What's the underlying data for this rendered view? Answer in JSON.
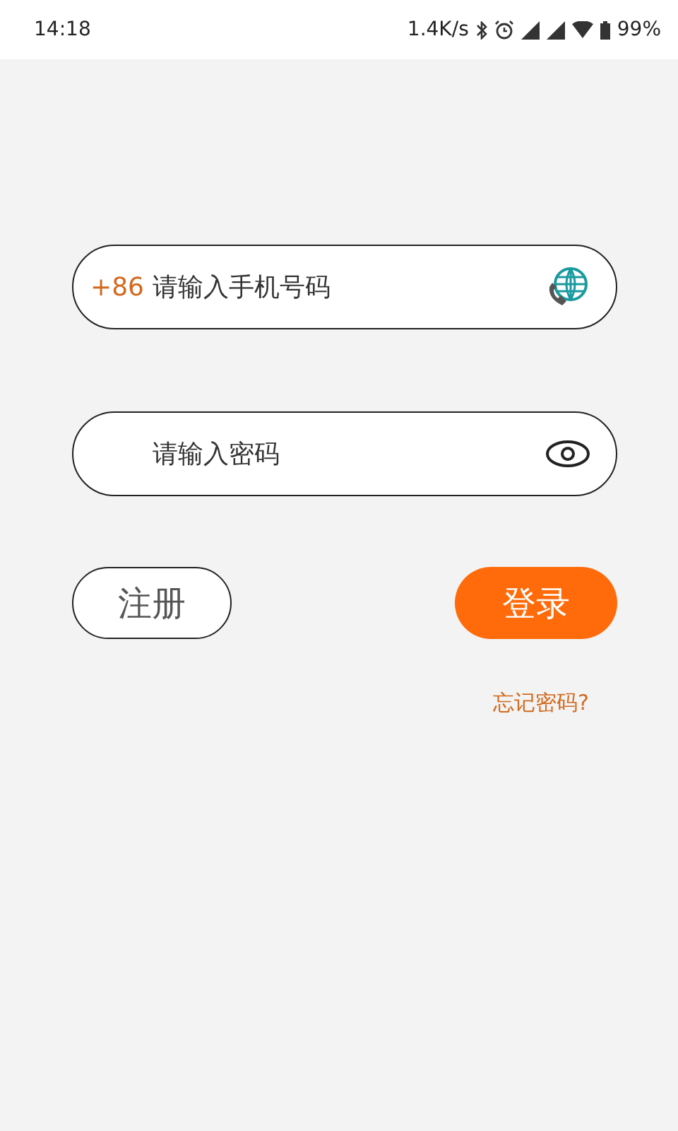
{
  "status_bar": {
    "time": "14:18",
    "speed": "1.4K/s",
    "battery": "99%"
  },
  "phone_field": {
    "country_code": "+86",
    "placeholder": "请输入手机号码"
  },
  "password_field": {
    "placeholder": "请输入密码"
  },
  "buttons": [
    {
      "kind": "outline",
      "label": "注册"
    },
    {
      "kind": "filled",
      "label": "登录"
    }
  ],
  "forgot_link": "忘记密码?"
}
